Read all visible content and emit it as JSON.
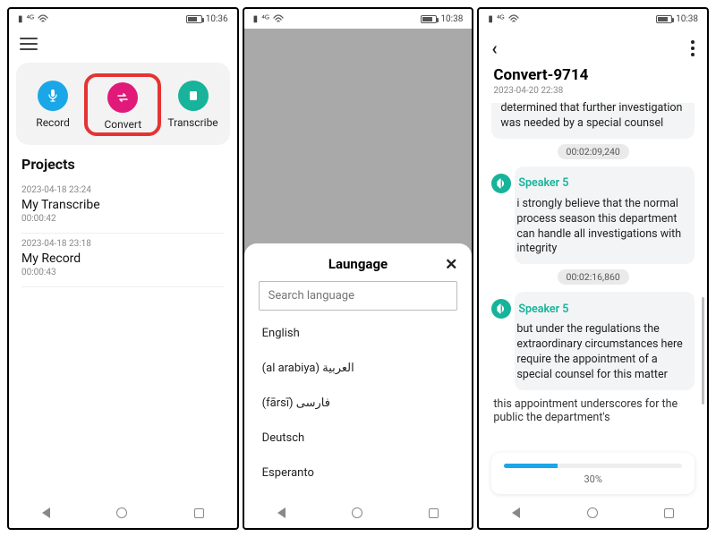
{
  "status": {
    "time1": "10:36",
    "time2": "10:38",
    "time3": "10:38"
  },
  "screen1": {
    "actions": {
      "record": "Record",
      "convert": "Convert",
      "transcribe": "Transcribe"
    },
    "projects_heading": "Projects",
    "projects": [
      {
        "date": "2023-04-18 23:24",
        "name": "My Transcribe",
        "duration": "00:00:42"
      },
      {
        "date": "2023-04-18 23:18",
        "name": "My Record",
        "duration": "00:00:43"
      }
    ]
  },
  "screen2": {
    "sheet_title": "Laungage",
    "search_placeholder": "Search language",
    "languages": [
      "English",
      "(al arabiya) العربية",
      "(fārsī) فارسی",
      "Deutsch",
      "Esperanto"
    ]
  },
  "screen3": {
    "title": "Convert-9714",
    "date": "2023-04-20 22:38",
    "lines": {
      "l0": "determined that further investigation was needed by a special counsel",
      "t0": "00:02:09,240",
      "spk1": "Speaker 5",
      "l1": "i strongly believe that the normal process season this department can handle all investigations with integrity",
      "t1": "00:02:16,860",
      "spk2": "Speaker 5",
      "l2": "but under the regulations the extraordinary circumstances here require the appointment of a special counsel for this matter",
      "l3": "this appointment underscores for the public the department's"
    },
    "progress_pct": "30%"
  }
}
